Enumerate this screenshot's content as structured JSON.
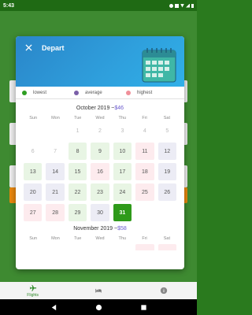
{
  "status": {
    "time": "5:43"
  },
  "dialog": {
    "title": "Depart",
    "legend": [
      {
        "label": "lowest",
        "color": "#2e9e22"
      },
      {
        "label": "average",
        "color": "#7a5fa8"
      },
      {
        "label": "highest",
        "color": "#f0909a"
      }
    ],
    "month1": {
      "name": "October 2019",
      "sep": " ~",
      "price": "$46",
      "weekdays": [
        "Sun",
        "Mon",
        "Tue",
        "Wed",
        "Thu",
        "Fri",
        "Sat"
      ],
      "days": [
        {
          "n": "",
          "t": "empty"
        },
        {
          "n": "",
          "t": "empty"
        },
        {
          "n": "1",
          "t": "faded"
        },
        {
          "n": "2",
          "t": "faded"
        },
        {
          "n": "3",
          "t": "faded"
        },
        {
          "n": "4",
          "t": "faded"
        },
        {
          "n": "5",
          "t": "faded"
        },
        {
          "n": "6",
          "t": "faded"
        },
        {
          "n": "7",
          "t": "faded"
        },
        {
          "n": "8",
          "t": "lowest"
        },
        {
          "n": "9",
          "t": "lowest"
        },
        {
          "n": "10",
          "t": "lowest"
        },
        {
          "n": "11",
          "t": "highest"
        },
        {
          "n": "12",
          "t": "average"
        },
        {
          "n": "13",
          "t": "lowest"
        },
        {
          "n": "14",
          "t": "average"
        },
        {
          "n": "15",
          "t": "lowest"
        },
        {
          "n": "16",
          "t": "highest"
        },
        {
          "n": "17",
          "t": "lowest"
        },
        {
          "n": "18",
          "t": "highest"
        },
        {
          "n": "19",
          "t": "average"
        },
        {
          "n": "20",
          "t": "average"
        },
        {
          "n": "21",
          "t": "average"
        },
        {
          "n": "22",
          "t": "lowest"
        },
        {
          "n": "23",
          "t": "lowest"
        },
        {
          "n": "24",
          "t": "lowest"
        },
        {
          "n": "25",
          "t": "highest"
        },
        {
          "n": "26",
          "t": "average"
        },
        {
          "n": "27",
          "t": "highest"
        },
        {
          "n": "28",
          "t": "highest"
        },
        {
          "n": "29",
          "t": "lowest"
        },
        {
          "n": "30",
          "t": "average"
        },
        {
          "n": "31",
          "t": "selected"
        },
        {
          "n": "",
          "t": "empty"
        },
        {
          "n": "",
          "t": "empty"
        }
      ]
    },
    "month2": {
      "name": "November 2019",
      "sep": " ~",
      "price": "$58",
      "weekdays": [
        "Sun",
        "Mon",
        "Tue",
        "Wed",
        "Thu",
        "Fri",
        "Sat"
      ]
    }
  },
  "bottom_nav": {
    "items": [
      {
        "label": "Flights",
        "icon": "airplane-icon",
        "active": true
      },
      {
        "label": "",
        "icon": "hotel-bed-icon",
        "active": false
      },
      {
        "label": "",
        "icon": "info-icon",
        "active": false
      }
    ]
  },
  "colors": {
    "accent": "#2f9a1a",
    "header": "#2fa0dd",
    "app_bar": "#2a7a1e"
  }
}
